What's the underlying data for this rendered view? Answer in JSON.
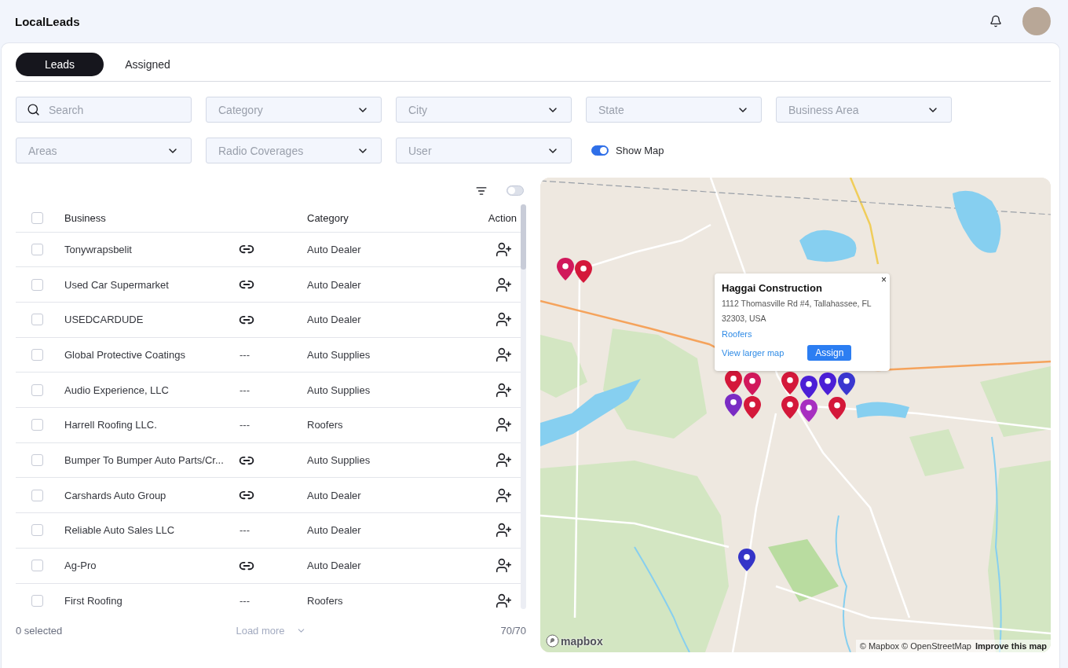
{
  "app": {
    "brand": "LocalLeads"
  },
  "tabs": [
    {
      "label": "Leads",
      "selected": true
    },
    {
      "label": "Assigned",
      "selected": false
    }
  ],
  "filters": {
    "search": {
      "placeholder": "Search"
    },
    "dropdowns": [
      {
        "placeholder": "Category"
      },
      {
        "placeholder": "City"
      },
      {
        "placeholder": "State"
      },
      {
        "placeholder": "Business Area"
      },
      {
        "placeholder": "Areas"
      },
      {
        "placeholder": "Radio Coverages"
      },
      {
        "placeholder": "User"
      }
    ],
    "show_map": {
      "label": "Show Map",
      "on": true
    }
  },
  "table": {
    "compact_toggle": {
      "on": false
    },
    "select_all": {
      "checked": false
    },
    "columns": [
      "Business",
      "Category",
      "Action"
    ],
    "rows": [
      {
        "checked": false,
        "business": "Tonywrapsbelit",
        "website": {
          "kind": "link"
        },
        "category": "Auto Dealer"
      },
      {
        "checked": false,
        "business": "Used Car Supermarket",
        "website": {
          "kind": "link"
        },
        "category": "Auto Dealer"
      },
      {
        "checked": false,
        "business": "USEDCARDUDE",
        "website": {
          "kind": "link"
        },
        "category": "Auto Dealer"
      },
      {
        "checked": false,
        "business": "Global Protective Coatings",
        "website": {
          "kind": "text",
          "text": "---"
        },
        "category": "Auto Supplies"
      },
      {
        "checked": false,
        "business": "Audio Experience, LLC",
        "website": {
          "kind": "text",
          "text": "---"
        },
        "category": "Auto Supplies"
      },
      {
        "checked": false,
        "business": "Harrell Roofing LLC.",
        "website": {
          "kind": "text",
          "text": "---"
        },
        "category": "Roofers"
      },
      {
        "checked": false,
        "business": "Bumper To Bumper Auto Parts/Cr...",
        "website": {
          "kind": "link"
        },
        "category": "Auto Supplies"
      },
      {
        "checked": false,
        "business": "Carshards Auto Group",
        "website": {
          "kind": "link"
        },
        "category": "Auto Dealer"
      },
      {
        "checked": false,
        "business": "Reliable Auto Sales LLC",
        "website": {
          "kind": "text",
          "text": "---"
        },
        "category": "Auto Dealer"
      },
      {
        "checked": false,
        "business": "Ag-Pro",
        "website": {
          "kind": "link"
        },
        "category": "Auto Dealer"
      },
      {
        "checked": false,
        "business": "First Roofing",
        "website": {
          "kind": "text",
          "text": "---"
        },
        "category": "Roofers"
      }
    ]
  },
  "footer": {
    "selected": "0 selected",
    "load_more": {
      "label": "Load more",
      "disabled": true
    },
    "count": "70/70"
  },
  "map": {
    "pins": [
      {
        "color": "#d4183a"
      },
      {
        "color": "#d1185b"
      },
      {
        "color": "#d4183a"
      },
      {
        "color": "#7a2cc4"
      },
      {
        "color": "#d1185b"
      },
      {
        "color": "#d4183a"
      },
      {
        "color": "#d4183a"
      },
      {
        "color": "#d4183a"
      },
      {
        "color": "#4b1fd6"
      },
      {
        "color": "#a72fc0"
      },
      {
        "color": "#4b1fd6"
      },
      {
        "color": "#d4183a"
      },
      {
        "color": "#3a37d0"
      },
      {
        "color": "#3434c8"
      }
    ],
    "popup": {
      "title": "Haggai Construction",
      "address": "1112 Thomasville Rd #4, Tallahassee, FL 32303, USA",
      "category": "Roofers",
      "link": "View larger map",
      "button": "Assign",
      "close": "×"
    },
    "logo": "mapbox",
    "attribution": "© Mapbox © OpenStreetMap",
    "improve": "Improve this map"
  }
}
